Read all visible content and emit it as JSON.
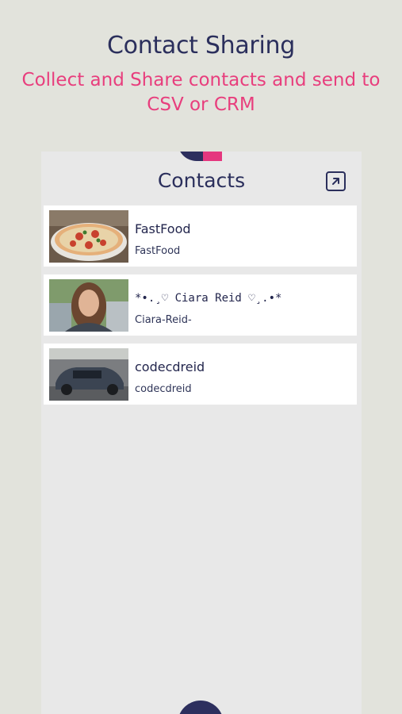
{
  "promo": {
    "title": "Contact Sharing",
    "subtitle_line1": "Collect and Share contacts and send to",
    "subtitle_line2": "CSV or CRM"
  },
  "screen": {
    "title": "Contacts",
    "export_icon": "arrow-up-right-square-icon"
  },
  "contacts": [
    {
      "name": "FastFood",
      "handle": "FastFood",
      "thumbnail": "pizza-photo"
    },
    {
      "name": "*•.¸♡ Ciara Reid ♡¸.•*",
      "handle": "Ciara-Reid-",
      "thumbnail": "portrait-photo"
    },
    {
      "name": "codecdreid",
      "handle": "codecdreid",
      "thumbnail": "car-photo"
    }
  ],
  "colors": {
    "background": "#e2e3dc",
    "navy": "#2b2f5c",
    "pink": "#e83e7d",
    "panel": "#e8e8e8"
  }
}
